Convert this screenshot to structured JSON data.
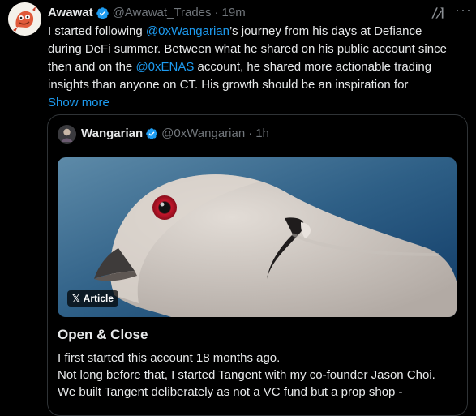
{
  "tweet": {
    "author_name": "Awawat",
    "author_handle": "@Awawat_Trades",
    "separator": "·",
    "time": "19m",
    "text": {
      "p1": "I started following ",
      "mention1": "@0xWangarian",
      "p2": "’s journey from his days at Defiance",
      "line2": "during DeFi summer. Between what he shared on his public account since",
      "p3": "then and on the ",
      "mention2": "@0xENAS",
      "p4": " account, he shared more actionable trading",
      "line4": "insights than anyone on CT. His growth should be an inspiration for"
    },
    "show_more": "Show more"
  },
  "quote": {
    "author_name": "Wangarian",
    "author_handle": "@0xWangarian",
    "separator": "·",
    "time": "1h",
    "badge": "Article",
    "article_title": "Open & Close",
    "article_lines": [
      "I first started this account 18 months ago.",
      "Not long before that, I started Tangent with my co-founder Jason Choi.",
      "We built Tangent deliberately as not a VC fund but a prop shop -"
    ]
  },
  "colors": {
    "background": "#000000",
    "text": "#e7e9ea",
    "muted": "#71767b",
    "link": "#1d9bf0",
    "border": "#2f3336"
  },
  "icons": {
    "verified": "verified-badge-icon",
    "grok": "grok-icon",
    "more": "more-options-icon",
    "x_logo": "x-logo-icon"
  }
}
